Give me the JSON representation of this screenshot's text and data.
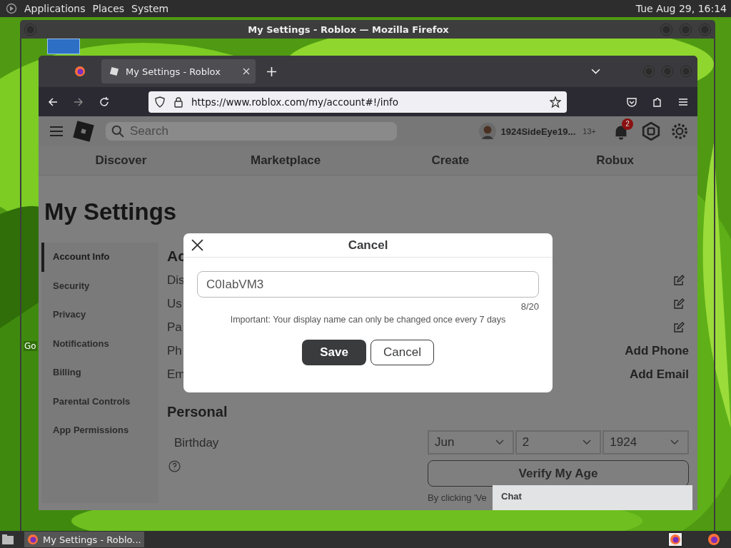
{
  "top_panel": {
    "menus": [
      "Applications",
      "Places",
      "System"
    ],
    "clock": "Tue Aug 29, 16:14"
  },
  "desktop": {
    "icon_label": "Go"
  },
  "window": {
    "title": "My Settings - Roblox — Mozilla Firefox"
  },
  "browser": {
    "tabs": [
      {
        "label": "My Settings - Roblox",
        "selected": true
      }
    ],
    "url": "https://www.roblox.com/my/account#!/info"
  },
  "site": {
    "search": {
      "placeholder": "Search"
    },
    "username": "1924SideEye19...",
    "age_badge": "13+",
    "notification_count": "2",
    "nav": [
      "Discover",
      "Marketplace",
      "Create",
      "Robux"
    ]
  },
  "page": {
    "title": "My Settings",
    "sidebar": [
      {
        "label": "Account Info",
        "selected": true
      },
      {
        "label": "Security",
        "selected": false
      },
      {
        "label": "Privacy",
        "selected": false
      },
      {
        "label": "Notifications",
        "selected": false
      },
      {
        "label": "Billing",
        "selected": false
      },
      {
        "label": "Parental Controls",
        "selected": false
      },
      {
        "label": "App Permissions",
        "selected": false
      }
    ],
    "account_title": "Ac",
    "account_rows": [
      {
        "label": "Dis",
        "kind": "edit"
      },
      {
        "label": "Us",
        "kind": "edit"
      },
      {
        "label": "Pa",
        "kind": "edit"
      },
      {
        "label": "Ph",
        "kind": "link",
        "action": "Add Phone"
      },
      {
        "label": "Em",
        "kind": "link",
        "action": "Add Email"
      }
    ],
    "personal": {
      "title": "Personal",
      "birthday_label": "Birthday",
      "month": "Jun",
      "day": "2",
      "year": "1924",
      "verify_button": "Verify My Age",
      "footnote": "By clicking 'Ve"
    }
  },
  "modal": {
    "title": "Cancel",
    "value": "C0IabVM3",
    "counter": "8/20",
    "notice": "Important: Your display name can only be changed once every 7 days",
    "save": "Save",
    "cancel": "Cancel"
  },
  "chat": {
    "label": "Chat"
  },
  "taskbar": {
    "items": [
      {
        "label": "My Settings - Roblo...",
        "selected": true
      }
    ]
  }
}
